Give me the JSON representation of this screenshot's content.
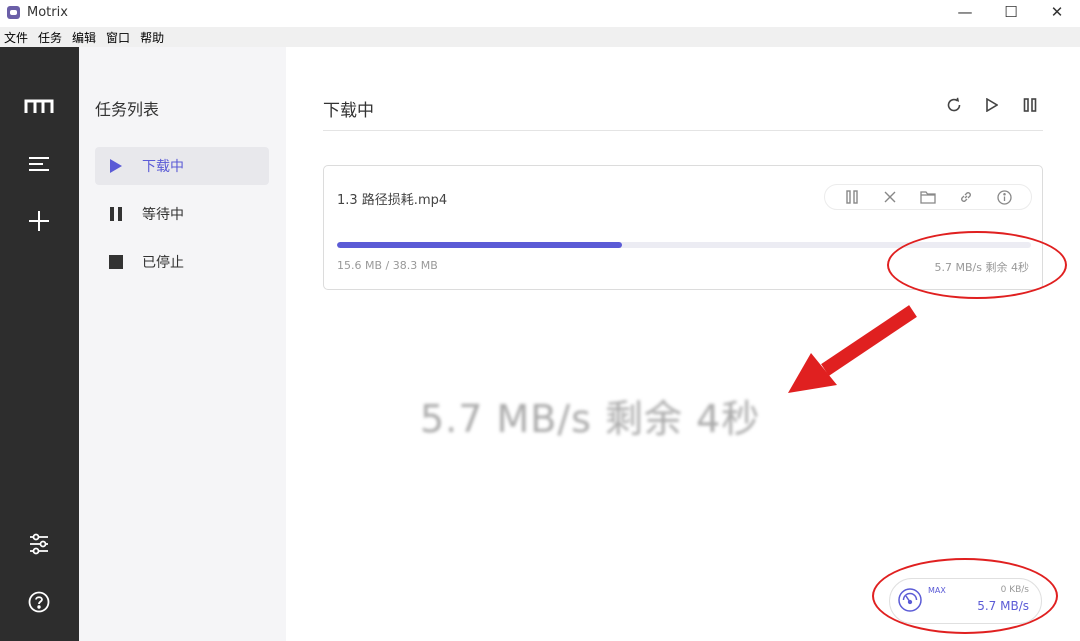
{
  "window": {
    "title": "Motrix",
    "controls": [
      "—",
      "☐",
      "✕"
    ]
  },
  "menu": [
    "文件",
    "任务",
    "编辑",
    "窗口",
    "帮助"
  ],
  "rail": {
    "icons": [
      "logo-icon",
      "menu-icon",
      "plus-icon",
      "preferences-icon",
      "help-icon"
    ]
  },
  "sidebar": {
    "title": "任务列表",
    "items": [
      {
        "label": "下载中",
        "icon": "play-icon",
        "active": true
      },
      {
        "label": "等待中",
        "icon": "pause-icon",
        "active": false
      },
      {
        "label": "已停止",
        "icon": "stop-icon",
        "active": false
      }
    ]
  },
  "main": {
    "title": "下载中",
    "actions": [
      "refresh-icon",
      "resume-all-icon",
      "pause-all-icon"
    ]
  },
  "task": {
    "name": "1.3 路径损耗.mp4",
    "size": "15.6 MB / 38.3 MB",
    "progress_percent": 41,
    "speed": "5.7 MB/s 剩余 4秒",
    "tools": [
      "pause-icon",
      "delete-icon",
      "folder-icon",
      "link-icon",
      "info-icon"
    ]
  },
  "callout": {
    "text": "5.7 MB/s 剩余 4秒"
  },
  "speed_meter": {
    "max_label": "MAX",
    "upload": "0 KB/s",
    "download": "5.7 MB/s"
  },
  "colors": {
    "accent": "#5b5bd6",
    "annotation": "#e02020",
    "rail": "#2d2d2d"
  }
}
